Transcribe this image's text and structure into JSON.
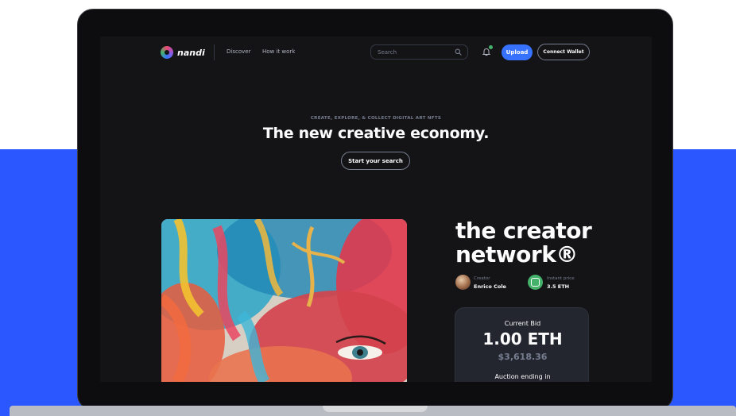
{
  "nav": {
    "logo_text": "nandi",
    "links": [
      {
        "label": "Discover"
      },
      {
        "label": "How it work"
      }
    ],
    "search_placeholder": "Search",
    "upload_label": "Upload",
    "wallet_label": "Connect Wallet"
  },
  "hero": {
    "eyebrow": "CREATE, EXPLORE, & COLLECT DIGITAL ART NFTS",
    "title": "The new creative economy.",
    "cta_label": "Start your search"
  },
  "item": {
    "title_line1": "the creator",
    "title_line2": "network®",
    "creator_label": "Creator",
    "creator_name": "Enrico Cole",
    "price_label": "Instant price",
    "price_value": "3.5 ETH"
  },
  "bid": {
    "label": "Current Bid",
    "eth": "1.00 ETH",
    "usd": "$3,618.36",
    "auction_label": "Auction ending in"
  },
  "colors": {
    "background_blue": "#2a57ff",
    "screen_bg": "#141416",
    "primary_button": "#3772ff",
    "accent_green": "#45b26b",
    "card_bg": "#23262f"
  }
}
